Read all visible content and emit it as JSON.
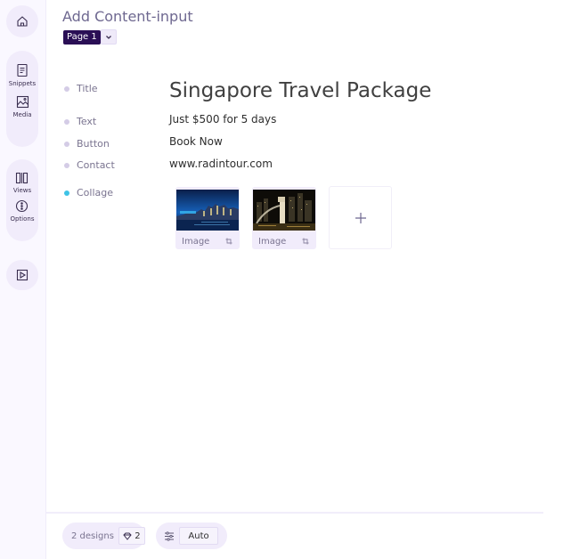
{
  "sidebar": {
    "items": [
      {
        "id": "home",
        "label": "",
        "icon": "home-icon"
      },
      {
        "id": "snippets",
        "label": "Snippets",
        "icon": "document-icon"
      },
      {
        "id": "media",
        "label": "Media",
        "icon": "image-icon"
      },
      {
        "id": "views",
        "label": "Views",
        "icon": "columns-icon"
      },
      {
        "id": "options",
        "label": "Options",
        "icon": "more-vertical-circle-icon"
      },
      {
        "id": "preview",
        "label": "",
        "icon": "play-icon"
      }
    ]
  },
  "header": {
    "title": "Add Content-input",
    "page_badge": "Page 1",
    "dropdown_icon": "chevron-down-icon"
  },
  "fields": [
    {
      "label": "Title",
      "value": "Singapore Travel Package",
      "active": false
    },
    {
      "label": "Text",
      "value": "Just $500 for 5 days",
      "active": false
    },
    {
      "label": "Button",
      "value": "Book Now",
      "active": false
    },
    {
      "label": "Contact",
      "value": "www.radintour.com",
      "active": false
    },
    {
      "label": "Collage",
      "value": "",
      "active": true
    }
  ],
  "collage": {
    "images": [
      {
        "label": "Image",
        "description": "Singapore skyline at night",
        "action_icon": "crop-icon"
      },
      {
        "label": "Image",
        "description": "Merlion fountain at night",
        "action_icon": "crop-icon"
      }
    ],
    "add_icon": "plus-icon"
  },
  "footer": {
    "designs_label": "2 designs",
    "designs_count": "2",
    "designs_icon": "gem-icon",
    "settings_icon": "sliders-icon",
    "auto_label": "Auto"
  },
  "colors": {
    "accent_dark": "#2a0f55",
    "active_dot": "#3ec3e6",
    "pill_bg": "#f1ecfb"
  }
}
